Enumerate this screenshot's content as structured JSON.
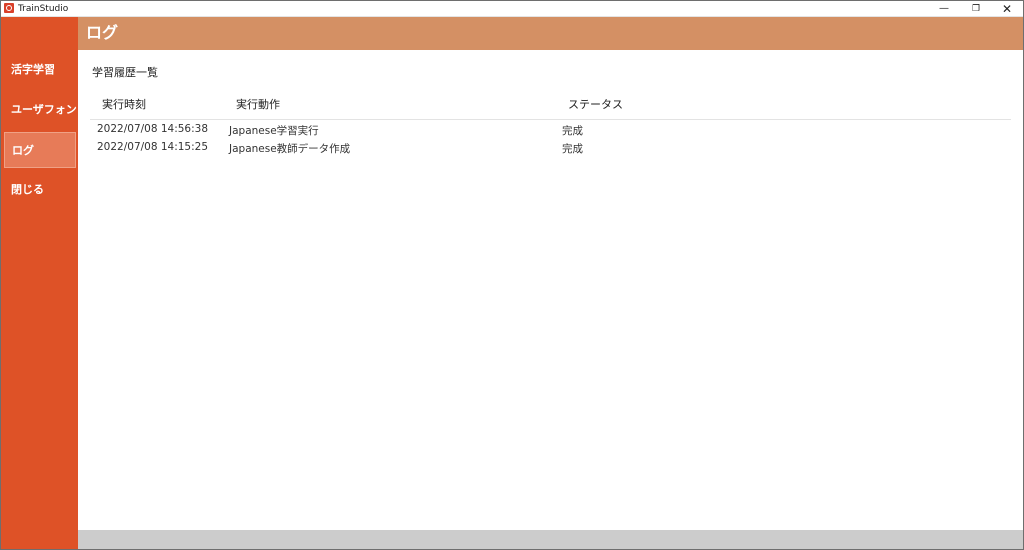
{
  "window": {
    "app_title": "TrainStudio",
    "controls": {
      "minimize": "—",
      "maximize": "❐",
      "close": "✕"
    }
  },
  "sidebar": {
    "items": [
      {
        "label": "活字学習"
      },
      {
        "label": "ユーザフォント"
      },
      {
        "label": "ログ",
        "active": true
      },
      {
        "label": "閉じる"
      }
    ]
  },
  "header": {
    "title": "ログ"
  },
  "log": {
    "section_title": "学習履歴一覧",
    "columns": [
      "実行時刻",
      "実行動作",
      "ステータス"
    ],
    "rows": [
      {
        "time": "2022/07/08 14:56:38",
        "action": "Japanese学習実行",
        "status": "完成"
      },
      {
        "time": "2022/07/08 14:15:25",
        "action": "Japanese教師データ作成",
        "status": "完成"
      }
    ]
  },
  "colors": {
    "sidebar": "#de5227",
    "sidebar_active": "#e77b58",
    "header": "#d49064",
    "footer": "#cccccc"
  },
  "icons": {
    "app_logo": "app-logo-icon"
  }
}
